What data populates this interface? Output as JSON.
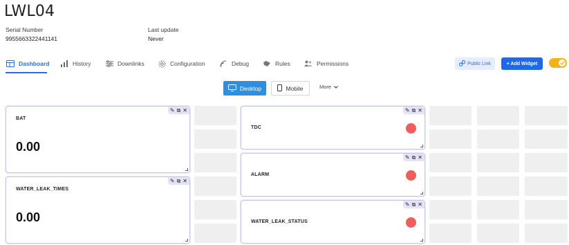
{
  "device": {
    "title": "LWL04",
    "serial_label": "Serial Number",
    "serial_value": "9955663322441141",
    "update_label": "Last update",
    "update_value": "Never"
  },
  "tabs": [
    {
      "label": "Dashboard",
      "icon": "dashboard-icon",
      "active": true
    },
    {
      "label": "History",
      "icon": "bar-chart-icon",
      "active": false
    },
    {
      "label": "Downlinks",
      "icon": "downlinks-icon",
      "active": false
    },
    {
      "label": "Configuration",
      "icon": "gear-icon",
      "active": false
    },
    {
      "label": "Debug",
      "icon": "signal-icon",
      "active": false
    },
    {
      "label": "Rules",
      "icon": "rules-icon",
      "active": false
    },
    {
      "label": "Permissions",
      "icon": "users-icon",
      "active": false
    }
  ],
  "toolbar": {
    "public_link": "Public Link",
    "add_widget": "+ Add Widget"
  },
  "views": {
    "desktop": "Desktop",
    "mobile": "Mobile",
    "more": "More"
  },
  "widgets": {
    "bat": {
      "title": "BAT",
      "value": "0.00"
    },
    "water_leak_times": {
      "title": "WATER_LEAK_TIMES",
      "value": "0.00"
    },
    "tdc": {
      "title": "TDC",
      "status_color": "#ef5d5d"
    },
    "alarm": {
      "title": "ALARM",
      "status_color": "#ef5d5d"
    },
    "water_leak_status": {
      "title": "WATER_LEAK_STATUS",
      "status_color": "#ef5d5d"
    }
  },
  "colors": {
    "accent": "#2e6bd8",
    "add_button": "#1f68e8",
    "desktop_button": "#2f8fde",
    "toggle": "#f5b21a",
    "status_off": "#ef5d5d"
  }
}
